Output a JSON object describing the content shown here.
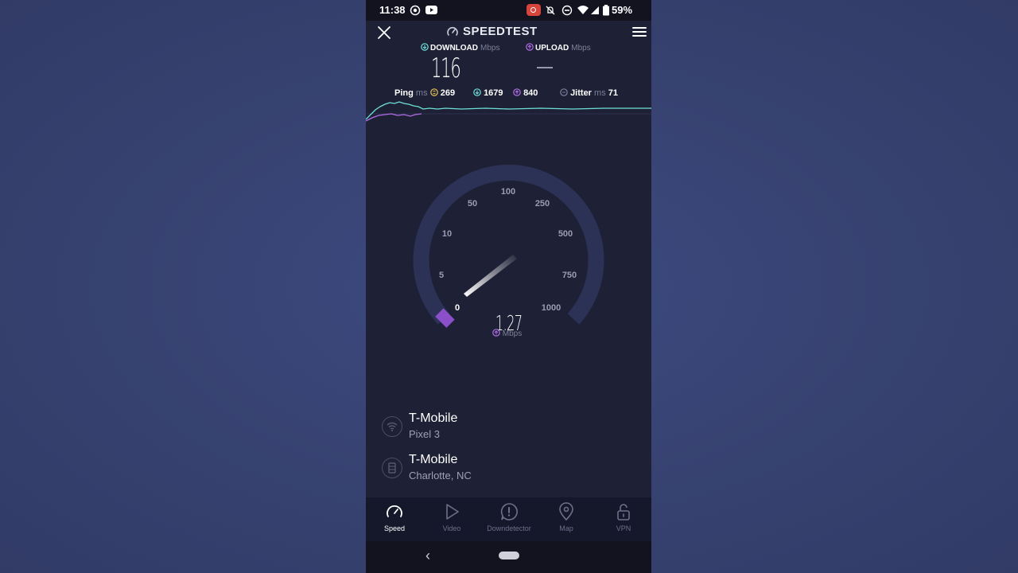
{
  "status_bar": {
    "time": "11:38",
    "battery": "59%"
  },
  "app": {
    "title": "SPEEDTEST"
  },
  "header": {
    "download_label": "DOWNLOAD",
    "download_unit": "Mbps",
    "upload_label": "UPLOAD",
    "upload_unit": "Mbps",
    "download_value": "116",
    "upload_value": "—"
  },
  "metrics": {
    "ping_label": "Ping",
    "ping_unit": "ms",
    "ping_idle": "269",
    "ping_download": "1679",
    "ping_upload": "840",
    "jitter_label": "Jitter",
    "jitter_unit": "ms",
    "jitter_value": "71"
  },
  "gauge": {
    "ticks": [
      "0",
      "5",
      "10",
      "50",
      "100",
      "250",
      "500",
      "750",
      "1000"
    ],
    "value": "1.27",
    "unit": "Mbps"
  },
  "connection": {
    "provider": {
      "name": "T-Mobile",
      "device": "Pixel 3",
      "icon": "wifi-icon"
    },
    "server": {
      "name": "T-Mobile",
      "location": "Charlotte, NC",
      "icon": "server-icon"
    }
  },
  "nav": [
    {
      "label": "Speed",
      "icon": "speed-icon",
      "active": true
    },
    {
      "label": "Video",
      "icon": "play-icon",
      "active": false
    },
    {
      "label": "Downdetector",
      "icon": "alert-icon",
      "active": false
    },
    {
      "label": "Map",
      "icon": "map-pin-icon",
      "active": false
    },
    {
      "label": "VPN",
      "icon": "lock-icon",
      "active": false
    }
  ],
  "colors": {
    "background": "#36416f",
    "app_bg": "#1e2035",
    "download_accent": "#6ee0d8",
    "upload_accent": "#b06ee6",
    "ping_accent": "#e5c35a"
  }
}
